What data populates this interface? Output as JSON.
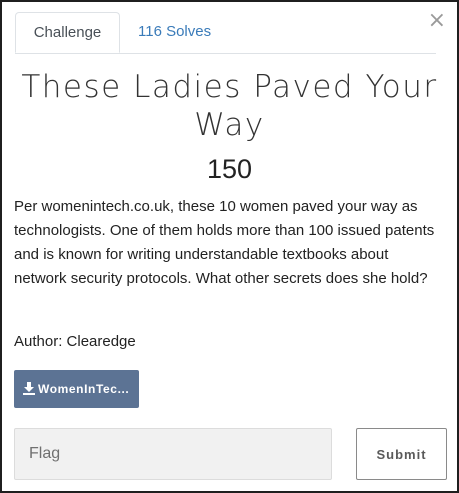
{
  "tabs": {
    "challenge_label": "Challenge",
    "solves_label": "116 Solves"
  },
  "close": {
    "symbol": "×"
  },
  "challenge": {
    "title": "These Ladies Paved Your Way",
    "points": "150",
    "description": "Per womenintech.co.uk, these 10 women paved your way as technologists. One of them holds more than 100 issued patents and is known for writing understandable textbooks about network security protocols. What other secrets does she hold?",
    "author": "Author: Clearedge"
  },
  "download": {
    "label": "WomenInTec...",
    "icon": "download-icon"
  },
  "flag": {
    "placeholder": "Flag",
    "value": ""
  },
  "submit": {
    "label": "Submit"
  },
  "colors": {
    "accent_link": "#3a7bb9",
    "download_button": "#5c7394",
    "input_background": "#f1f1f1"
  }
}
